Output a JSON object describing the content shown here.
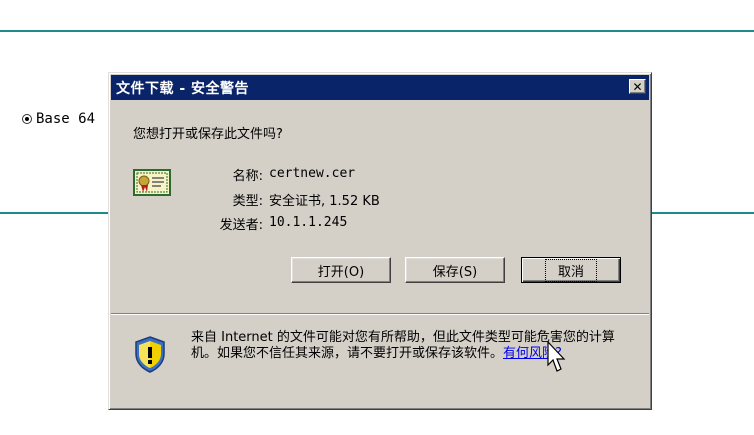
{
  "background": {
    "radio_label": "Base 64"
  },
  "dialog": {
    "title": "文件下载 - 安全警告",
    "close_glyph": "✕",
    "question": "您想打开或保存此文件吗?",
    "file_icon": "certificate-icon",
    "fields": {
      "name_label": "名称:",
      "name_value": "certnew.cer",
      "type_label": "类型:",
      "type_value": "安全证书, 1.52 KB",
      "from_label": "发送者:",
      "from_value": "10.1.1.245"
    },
    "buttons": {
      "open": "打开(O)",
      "save": "保存(S)",
      "cancel": "取消"
    },
    "warning": {
      "icon": "shield-warning-icon",
      "text": "来自 Internet 的文件可能对您有所帮助，但此文件类型可能危害您的计算机。如果您不信任其来源，请不要打开或保存该软件。",
      "link": "有何风险?"
    }
  },
  "colors": {
    "titlebar": "#0a246a",
    "dialog_bg": "#d4d0c8",
    "rule": "#1f8a8a",
    "link": "#0000ee"
  }
}
